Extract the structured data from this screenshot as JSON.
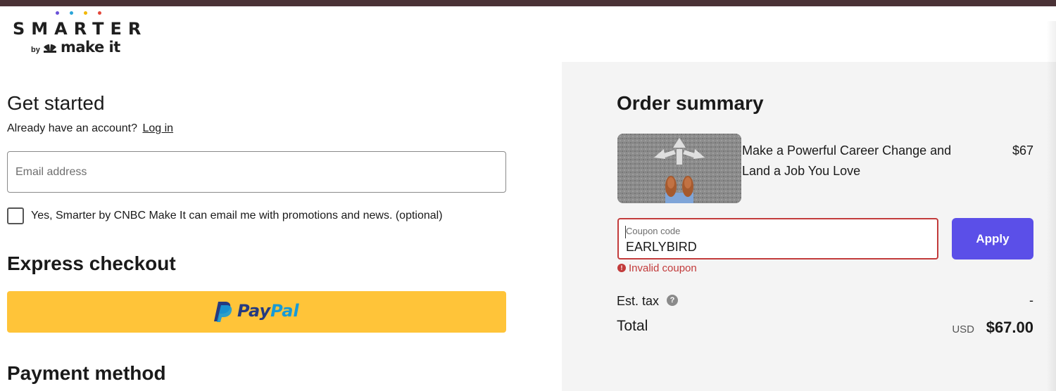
{
  "brand": {
    "wordmark": "SMARTER",
    "by": "by",
    "network": "CNBC",
    "product": "make it",
    "dot_colors": [
      "#6a52d8",
      "#2aa5d8",
      "#f2b705",
      "#e3473a"
    ]
  },
  "account": {
    "heading": "Get started",
    "prompt": "Already have an account?",
    "login_link": "Log in",
    "email_placeholder": "Email address",
    "email_value": "",
    "optin_label": "Yes, Smarter by CNBC Make It can email me with promotions and news. (optional)",
    "optin_checked": false
  },
  "express": {
    "heading": "Express checkout",
    "button_text_dark": "Pay",
    "button_text_light": "Pal",
    "button_color": "#ffc439"
  },
  "payment": {
    "heading": "Payment method"
  },
  "summary": {
    "heading": "Order summary",
    "product": {
      "title": "Make a Powerful Career Change and Land a Job You Love",
      "price": "$67",
      "image": "person-standing-at-crossroads-arrows"
    },
    "coupon": {
      "label": "Coupon code",
      "value": "EARLYBIRD",
      "apply_label": "Apply",
      "error": "Invalid coupon",
      "error_color": "#c23b3b",
      "apply_color": "#5b4fe8"
    },
    "tax": {
      "label": "Est. tax",
      "value": "-"
    },
    "total": {
      "label": "Total",
      "currency": "USD",
      "value": "$67.00"
    }
  }
}
